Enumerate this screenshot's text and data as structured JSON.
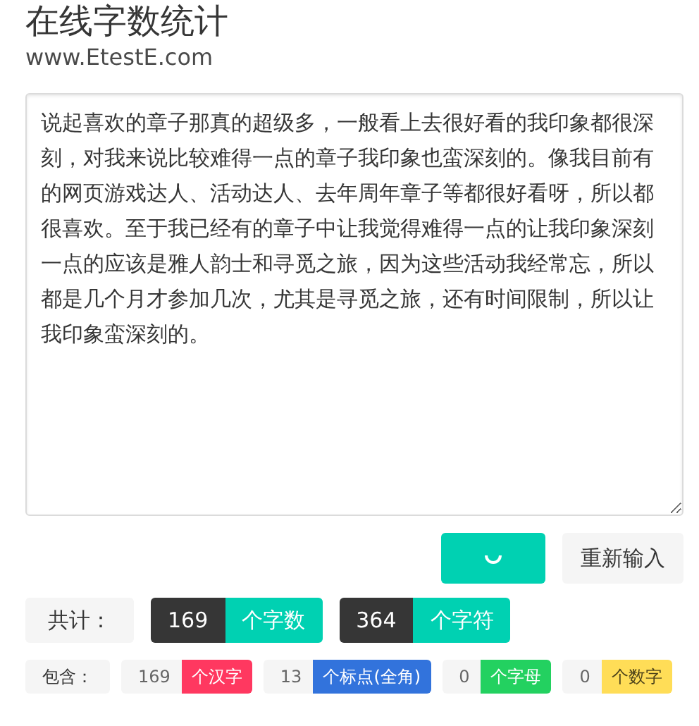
{
  "header": {
    "title": "在线字数统计",
    "subtitle": "www.EtestE.com"
  },
  "editor": {
    "value": "说起喜欢的章子那真的超级多，一般看上去很好看的我印象都很深刻，对我来说比较难得一点的章子我印象也蛮深刻的。像我目前有的网页游戏达人、活动达人、去年周年章子等都很好看呀，所以都很喜欢。至于我已经有的章子中让我觉得难得一点的让我印象深刻一点的应该是雅人韵士和寻觅之旅，因为这些活动我经常忘，所以都是几个月才参加几次，尤其是寻觅之旅，还有时间限制，所以让我印象蛮深刻的。"
  },
  "buttons": {
    "count_loading": true,
    "reset": "重新输入"
  },
  "totals": {
    "label": "共计：",
    "items": [
      {
        "count": "169",
        "unit": "个字数",
        "color": "#00d1b2"
      },
      {
        "count": "364",
        "unit": "个字符",
        "color": "#00d1b2"
      }
    ]
  },
  "breakdown": {
    "label": "包含：",
    "items": [
      {
        "count": "169",
        "unit": "个汉字",
        "color": "#ff3860"
      },
      {
        "count": "13",
        "unit": "个标点(全角)",
        "color": "#3273dc"
      },
      {
        "count": "0",
        "unit": "个字母",
        "color": "#23d160"
      },
      {
        "count": "0",
        "unit": "个数字",
        "color": "#ffdd57"
      }
    ]
  }
}
